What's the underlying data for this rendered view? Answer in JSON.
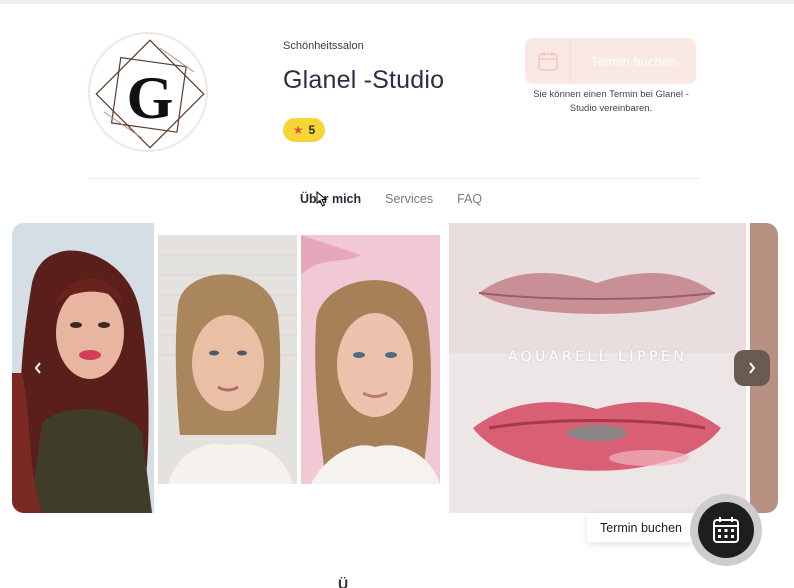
{
  "header": {
    "category": "Schönheitssalon",
    "title": "Glanel -Studio",
    "rating": "5",
    "logo_letter": "G"
  },
  "booking": {
    "button_label": "Termin buchen",
    "note": "Sie können einen Termin bei Glanel - Studio vereinbaren."
  },
  "tabs": [
    {
      "label": "Über mich",
      "active": true
    },
    {
      "label": "Services",
      "active": false
    },
    {
      "label": "FAQ",
      "active": false
    }
  ],
  "gallery": {
    "caption": "AQUARELL LIPPEN",
    "prev_icon": "chevron-left-icon",
    "next_icon": "chevron-right-icon"
  },
  "floating": {
    "label": "Termin buchen",
    "icon": "calendar-icon"
  },
  "bottom": {
    "partial_heading": "Ü"
  },
  "colors": {
    "rating_bg": "#f7d536",
    "booking_bg": "#f9e8e3",
    "arrow_bg": "#6a5a52",
    "title": "#2d2d44"
  }
}
